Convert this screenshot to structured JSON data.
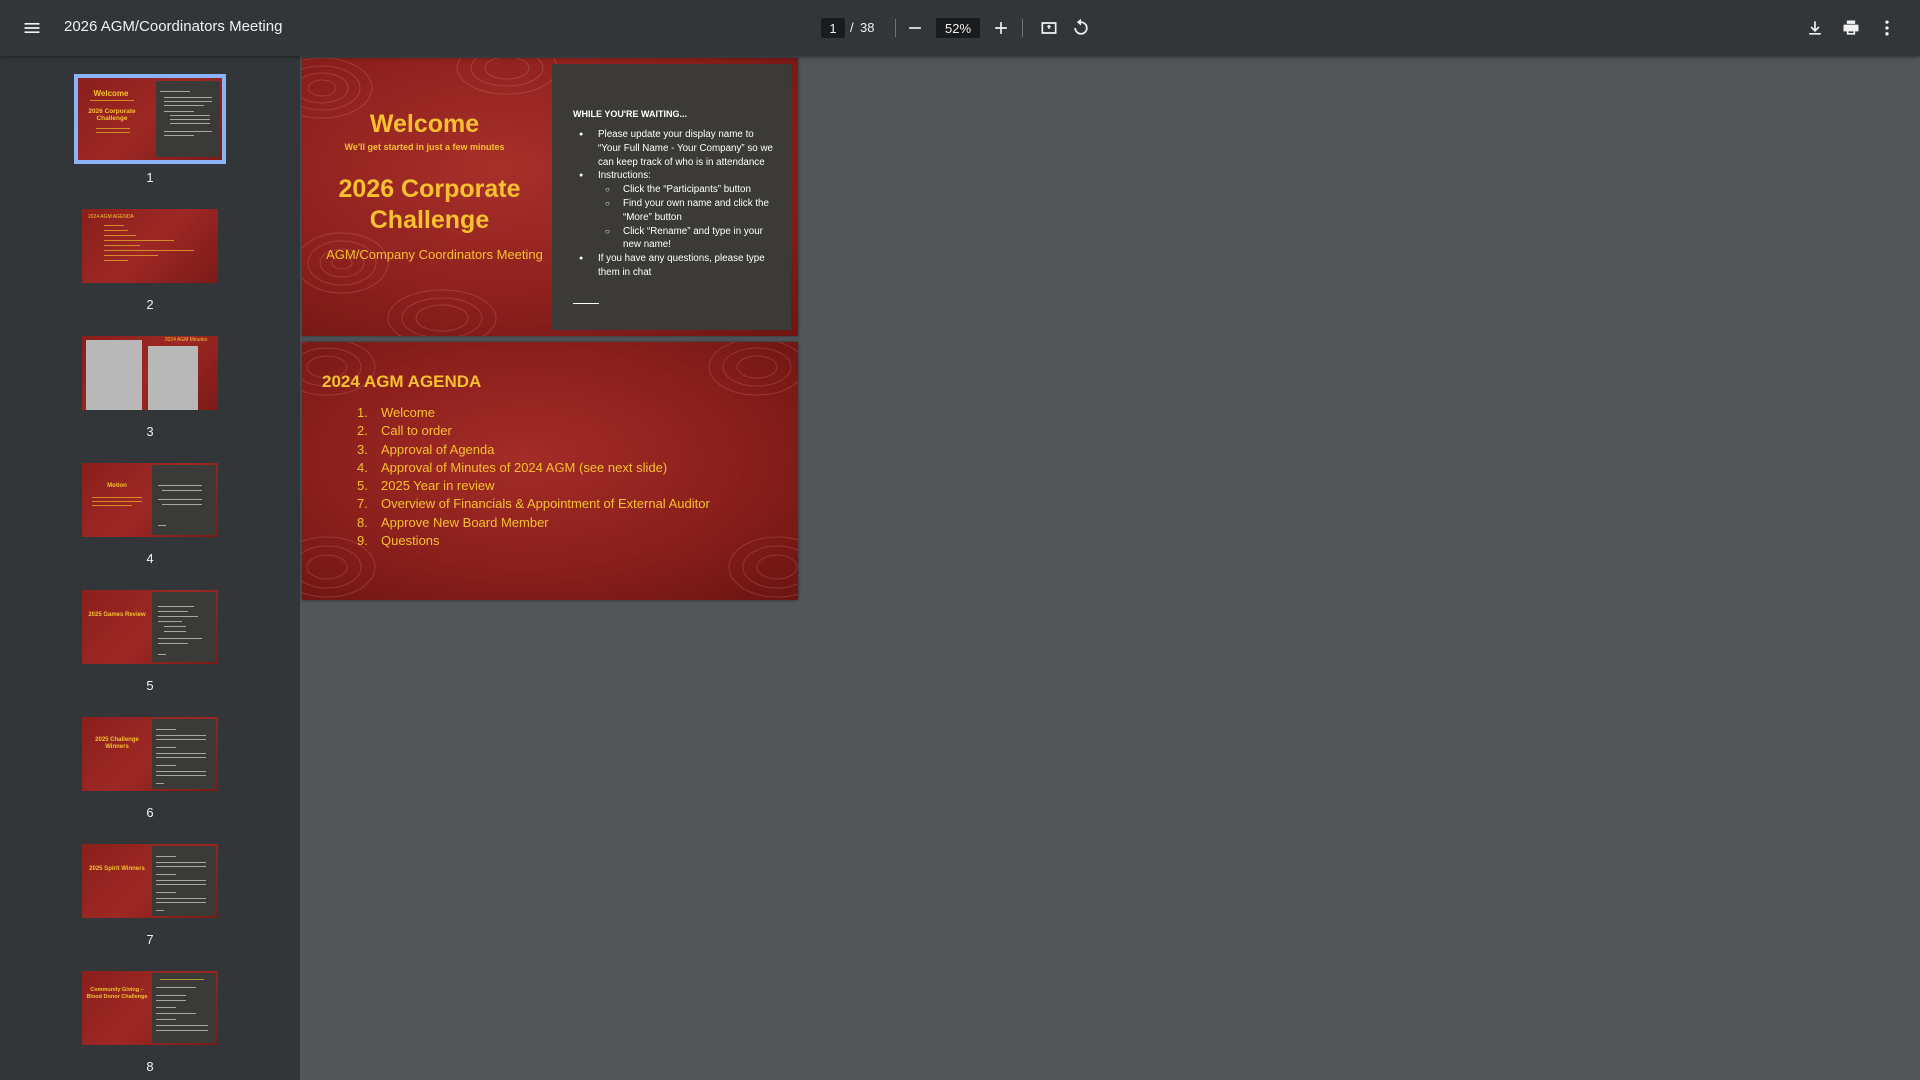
{
  "toolbar": {
    "title": "2026 AGM/Coordinators Meeting",
    "current_page": "1",
    "page_separator": "/",
    "total_pages": "38",
    "zoom": "52%",
    "icons": [
      "menu-icon",
      "zoom-out-icon",
      "zoom-in-icon",
      "fit-page-icon",
      "rotate-icon",
      "download-icon",
      "print-icon",
      "more-vert-icon"
    ]
  },
  "sidebar": {
    "thumbnails": [
      {
        "number": "1",
        "selected": true
      },
      {
        "number": "2",
        "selected": false
      },
      {
        "number": "3",
        "selected": false
      },
      {
        "number": "4",
        "selected": false
      },
      {
        "number": "5",
        "selected": false
      },
      {
        "number": "6",
        "selected": false
      },
      {
        "number": "7",
        "selected": false
      },
      {
        "number": "8",
        "selected": false
      }
    ],
    "thumb_texts": {
      "t2": "2024 AGM AGENDA",
      "t3": "2024 AGM Minutes",
      "t4": "Motion",
      "t5": "2025 Games Review",
      "t6": "2025 Challenge Winners",
      "t7": "2025 Spirit Winners",
      "t8": "Community Giving – Blood Donor Challenge"
    }
  },
  "slides": {
    "slide1": {
      "welcome": "Welcome",
      "subtitle": "We'll get started in just a few minutes",
      "challenge": "2026 Corporate Challenge",
      "meeting": "AGM/Company Coordinators Meeting",
      "waiting_heading": "WHILE YOU'RE WAITING...",
      "bullet1": "Please update your display name to “Your Full Name - Your Company” so we can keep track of who is in attendance",
      "bullet2": "Instructions:",
      "sub1": "Click the “Participants” button",
      "sub2": "Find your own name and click the “More” button",
      "sub3": "Click “Rename” and type in your new name!",
      "bullet3": "If you have any questions, please type them in chat"
    },
    "slide2": {
      "title": "2024 AGM AGENDA",
      "items": [
        {
          "n": "1.",
          "text": "Welcome"
        },
        {
          "n": "2.",
          "text": "Call to order"
        },
        {
          "n": "3.",
          "text": "Approval of Agenda"
        },
        {
          "n": "4.",
          "text": "Approval of Minutes of 2024 AGM (see next slide)"
        },
        {
          "n": "5.",
          "text": "2025 Year in review"
        },
        {
          "n": "7.",
          "text": "Overview of Financials & Appointment of External Auditor"
        },
        {
          "n": "8.",
          "text": "Approve New Board Member"
        },
        {
          "n": "9.",
          "text": "Questions"
        }
      ]
    }
  },
  "colors": {
    "toolbar": "#323639",
    "viewer_bg": "#525659",
    "slide_red": "#8b1c1a",
    "slide_gold": "#f7c12f",
    "panel_dark": "#3b3a36",
    "selection": "#8ab4f8"
  }
}
